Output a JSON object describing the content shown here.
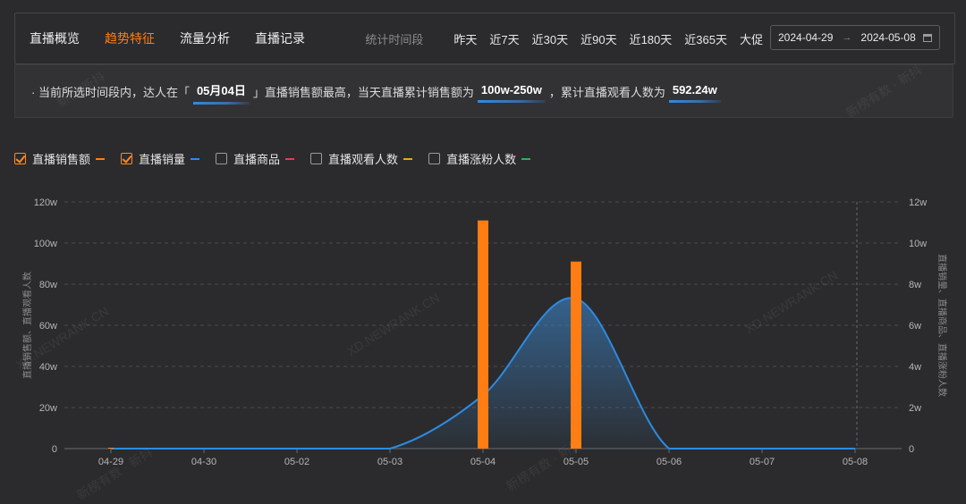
{
  "tabs": [
    {
      "label": "直播概览",
      "active": false
    },
    {
      "label": "趋势特征",
      "active": true
    },
    {
      "label": "流量分析",
      "active": false
    },
    {
      "label": "直播记录",
      "active": false
    }
  ],
  "period": {
    "label": "统计时间段",
    "options": [
      "昨天",
      "近7天",
      "近30天",
      "近90天",
      "近180天",
      "近365天",
      "大促"
    ],
    "start": "2024-04-29",
    "end": "2024-05-08",
    "arrow": "→"
  },
  "summary": {
    "prefix": "· 当前所选时间段内，达人在「",
    "date": "05月04日",
    "mid": "」直播销售额最高，当天直播累计销售额为",
    "sales": "100w-250w",
    "mid2": "，累计直播观看人数为",
    "viewers": "592.24w"
  },
  "legend": [
    {
      "label": "直播销售额",
      "checked": true,
      "color": "#ff7d12"
    },
    {
      "label": "直播销量",
      "checked": true,
      "color": "#2d8be0"
    },
    {
      "label": "直播商品",
      "checked": false,
      "color": "#e0404a"
    },
    {
      "label": "直播观看人数",
      "checked": false,
      "color": "#e0a82a"
    },
    {
      "label": "直播涨粉人数",
      "checked": false,
      "color": "#2fae5a"
    }
  ],
  "watermarks": [
    "新榜·新抖",
    "新榜有数 · 新抖",
    "XD.NEWRANK.CN",
    "XD.NEWRANK.CN",
    "新榜有数 · 新抖",
    "XD.NEWRANK.CN",
    "新榜有数 · 新抖"
  ],
  "chart_data": {
    "type": "bar+area",
    "categories": [
      "04-29",
      "04-30",
      "05-02",
      "05-03",
      "05-04",
      "05-05",
      "05-06",
      "05-07",
      "05-08"
    ],
    "left_axis": {
      "label": "直播销售额、直播观看人数",
      "ticks": [
        "0",
        "20w",
        "40w",
        "60w",
        "80w",
        "100w",
        "120w"
      ],
      "ylim": [
        0,
        120
      ]
    },
    "right_axis": {
      "label": "直播销量、直播商品、直播涨粉人数",
      "ticks": [
        "0",
        "2w",
        "4w",
        "6w",
        "8w",
        "10w",
        "12w"
      ],
      "ylim": [
        0,
        12
      ]
    },
    "series": [
      {
        "name": "直播销售额",
        "type": "bar",
        "axis": "left",
        "color": "#ff7d12",
        "values": [
          0,
          0,
          0,
          0,
          111,
          91,
          0,
          0,
          0
        ]
      },
      {
        "name": "直播销量",
        "type": "area",
        "axis": "right",
        "color": "#2d8be0",
        "values": [
          0,
          0,
          0,
          0,
          2.6,
          7.3,
          0,
          0,
          0
        ]
      }
    ],
    "grid": true
  }
}
